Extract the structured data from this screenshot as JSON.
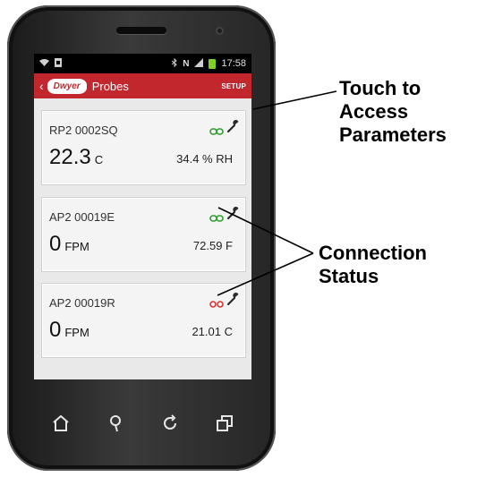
{
  "statusbar": {
    "time": "17:58"
  },
  "appbar": {
    "back": "‹",
    "logo": "Dwyer",
    "title": "Probes",
    "setup": "SETUP"
  },
  "cards": [
    {
      "id": "RP2 0002SQ",
      "value": "22.3",
      "unit": "C",
      "secondary": "34.4  % RH",
      "connection": "connected",
      "connection_color": "#2e9e2e"
    },
    {
      "id": "AP2 00019E",
      "value": "0",
      "unit": "FPM",
      "secondary": "72.59  F",
      "connection": "connected",
      "connection_color": "#2e9e2e"
    },
    {
      "id": "AP2 00019R",
      "value": "0",
      "unit": "FPM",
      "secondary": "21.01  C",
      "connection": "disconnected",
      "connection_color": "#d33"
    }
  ],
  "callouts": {
    "parameters": "Touch to\nAccess\nParameters",
    "connection": "Connection\nStatus"
  },
  "colors": {
    "appbar": "#c1272d",
    "battery": "#7dd321"
  },
  "icons": [
    "home-icon",
    "search-icon",
    "refresh-icon",
    "recent-apps-icon",
    "link-icon",
    "wrench-icon"
  ]
}
